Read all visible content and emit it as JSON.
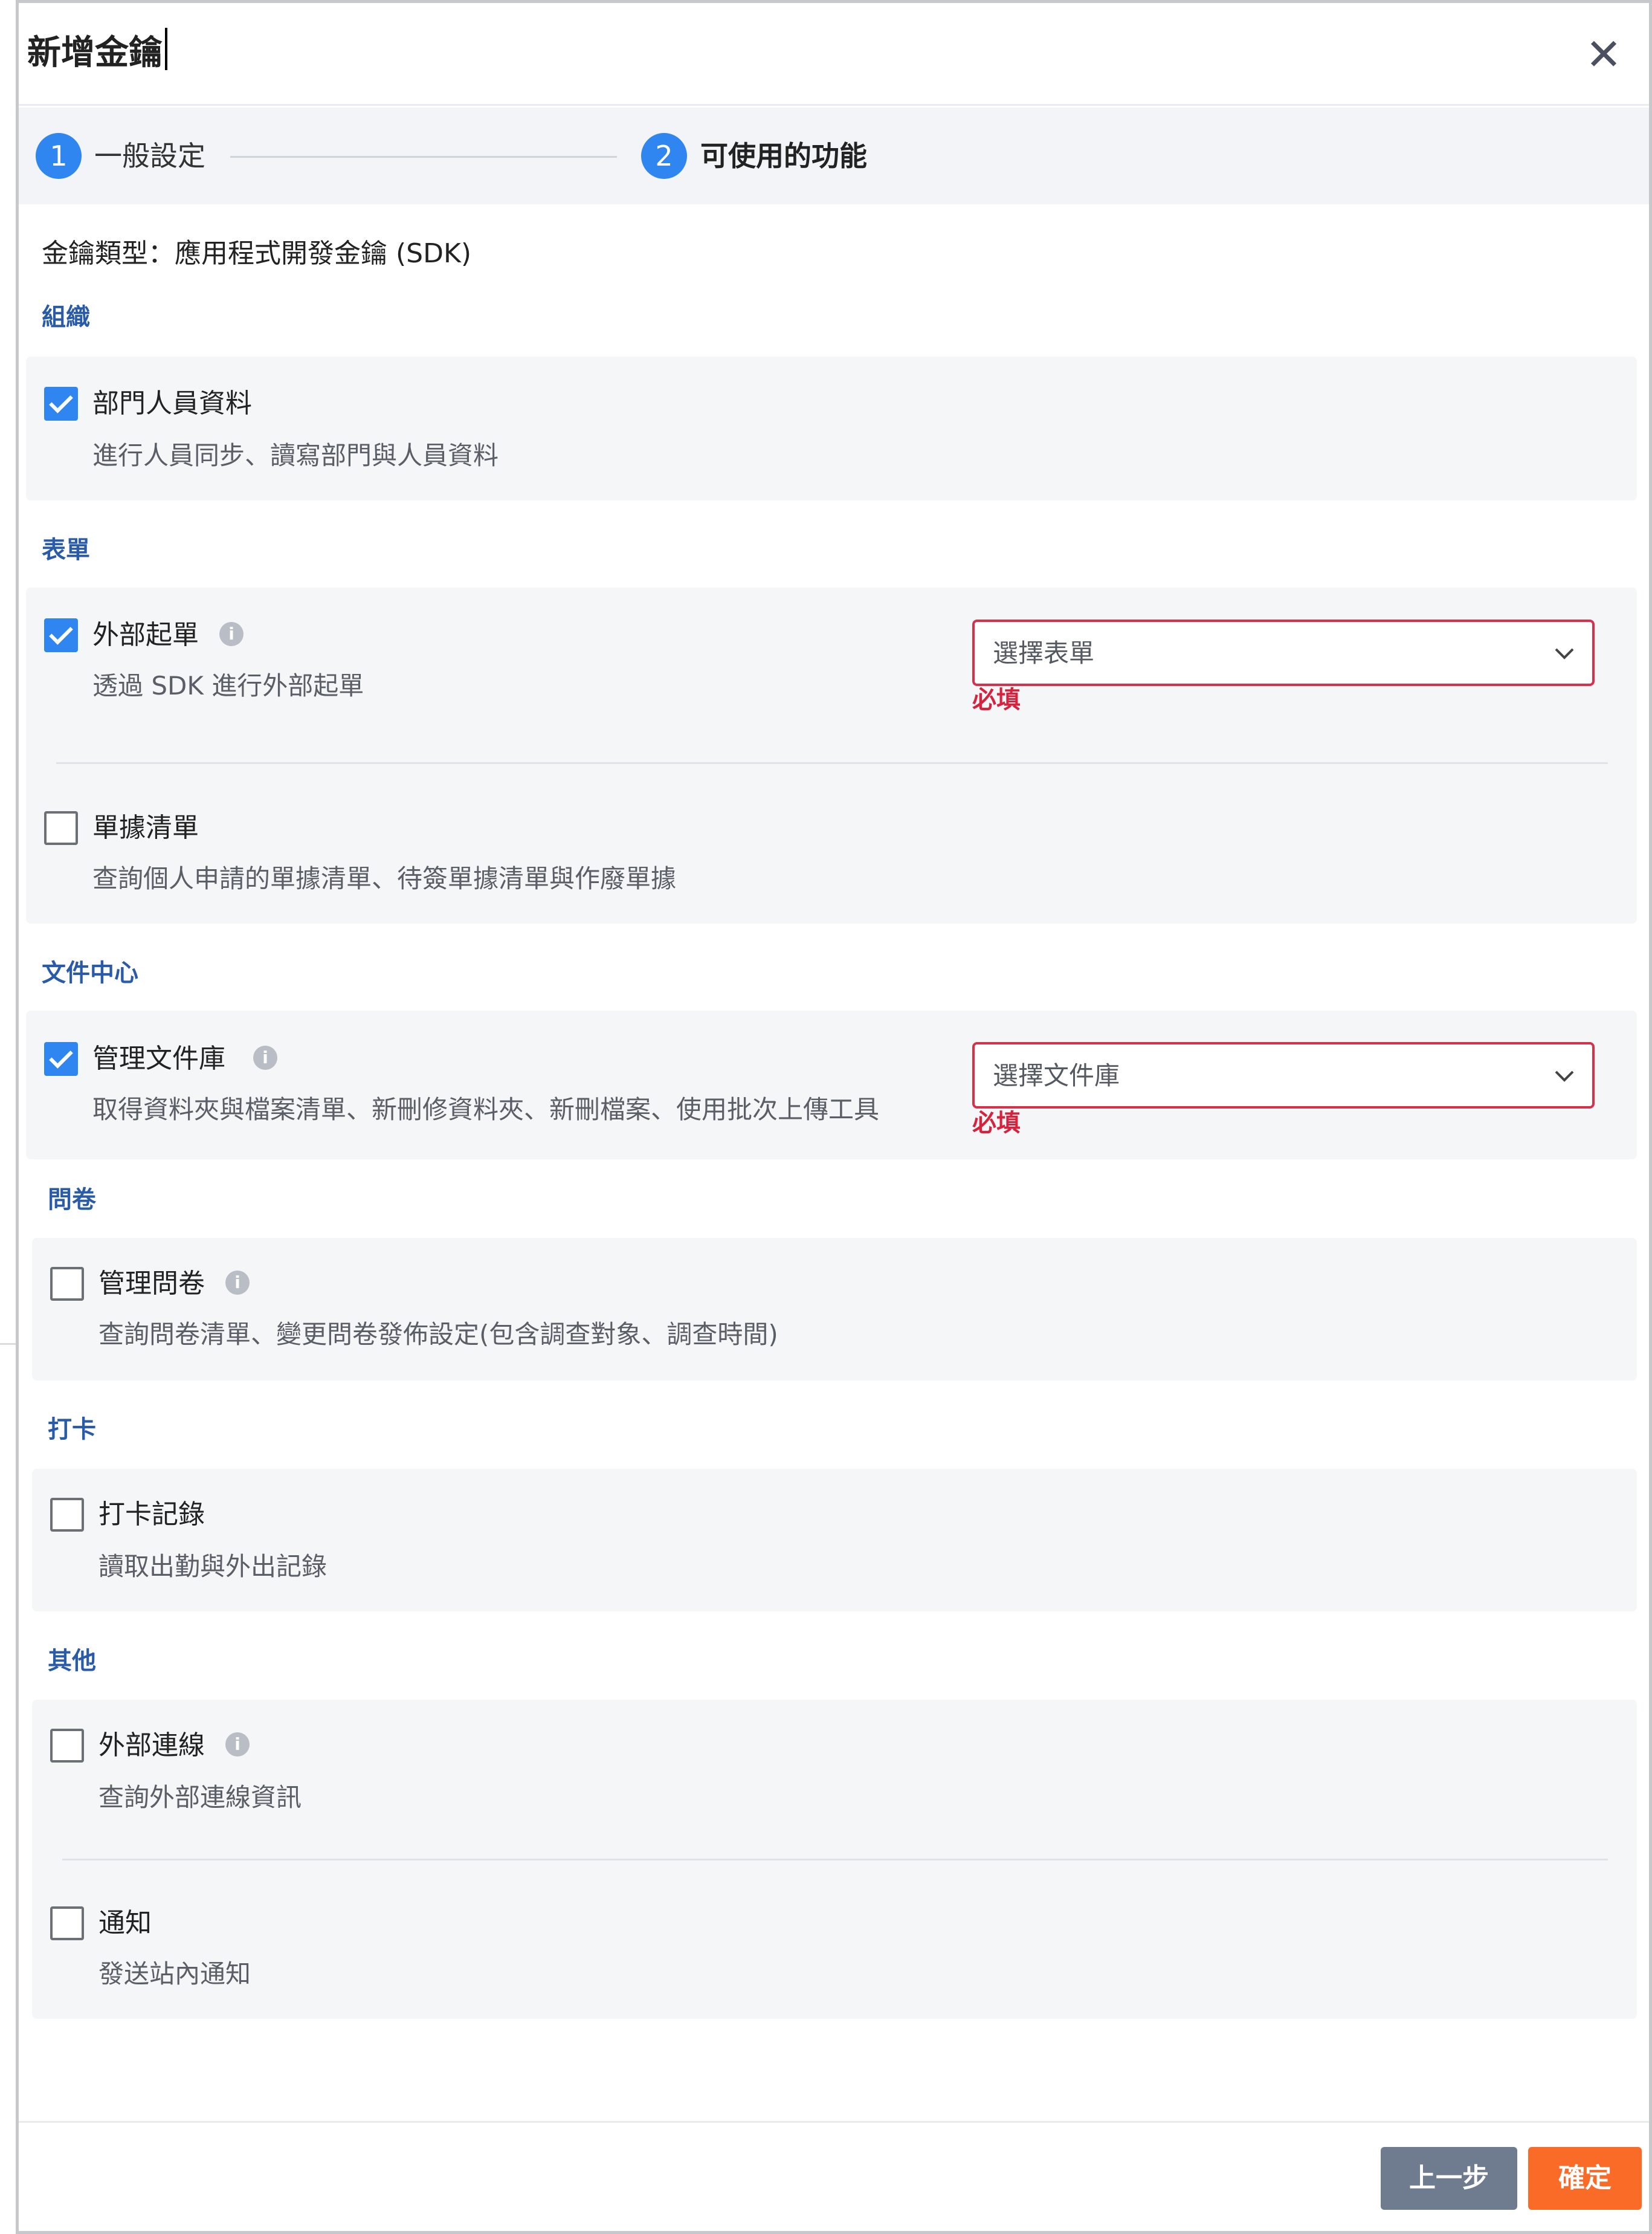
{
  "dialog": {
    "title": "新增金鑰",
    "close_glyph": "✕"
  },
  "steps": [
    {
      "number": "1",
      "label": "一般設定"
    },
    {
      "number": "2",
      "label": "可使用的功能"
    }
  ],
  "key_type": "金鑰類型：應用程式開發金鑰 (SDK)",
  "sections": {
    "org": {
      "title": "組織",
      "items": [
        {
          "label": "部門人員資料",
          "desc": "進行人員同步、讀寫部門與人員資料",
          "checked": true
        }
      ]
    },
    "form": {
      "title": "表單",
      "items": [
        {
          "label": "外部起單",
          "desc": "透過 SDK 進行外部起單",
          "checked": true,
          "select_placeholder": "選擇表單",
          "required": "必填"
        },
        {
          "label": "單據清單",
          "desc": "查詢個人申請的單據清單、待簽單據清單與作廢單據",
          "checked": false
        }
      ]
    },
    "docs": {
      "title": "文件中心",
      "items": [
        {
          "label": "管理文件庫",
          "desc": "取得資料夾與檔案清單、新刪修資料夾、新刪檔案、使用批次上傳工具",
          "checked": true,
          "select_placeholder": "選擇文件庫",
          "required": "必填"
        }
      ]
    },
    "survey": {
      "title": "問卷",
      "items": [
        {
          "label": "管理問卷",
          "desc": "查詢問卷清單、變更問卷發佈設定(包含調查對象、調查時間)",
          "checked": false
        }
      ]
    },
    "punch": {
      "title": "打卡",
      "items": [
        {
          "label": "打卡記錄",
          "desc": "讀取出勤與外出記錄",
          "checked": false
        }
      ]
    },
    "other": {
      "title": "其他",
      "items": [
        {
          "label": "外部連線",
          "desc": "查詢外部連線資訊",
          "checked": false
        },
        {
          "label": "通知",
          "desc": "發送站內通知",
          "checked": false
        }
      ]
    }
  },
  "footer": {
    "prev_label": "上一步",
    "ok_label": "確定"
  },
  "colors": {
    "primary": "#2f86f0",
    "section_title": "#2a5ba8",
    "error": "#d6223c",
    "confirm": "#fb6b28",
    "prev": "#6f7c90"
  },
  "icons": {
    "close": "close-icon",
    "info": "info-icon",
    "chevron": "chevron-down-icon",
    "checkbox": "checkbox"
  }
}
